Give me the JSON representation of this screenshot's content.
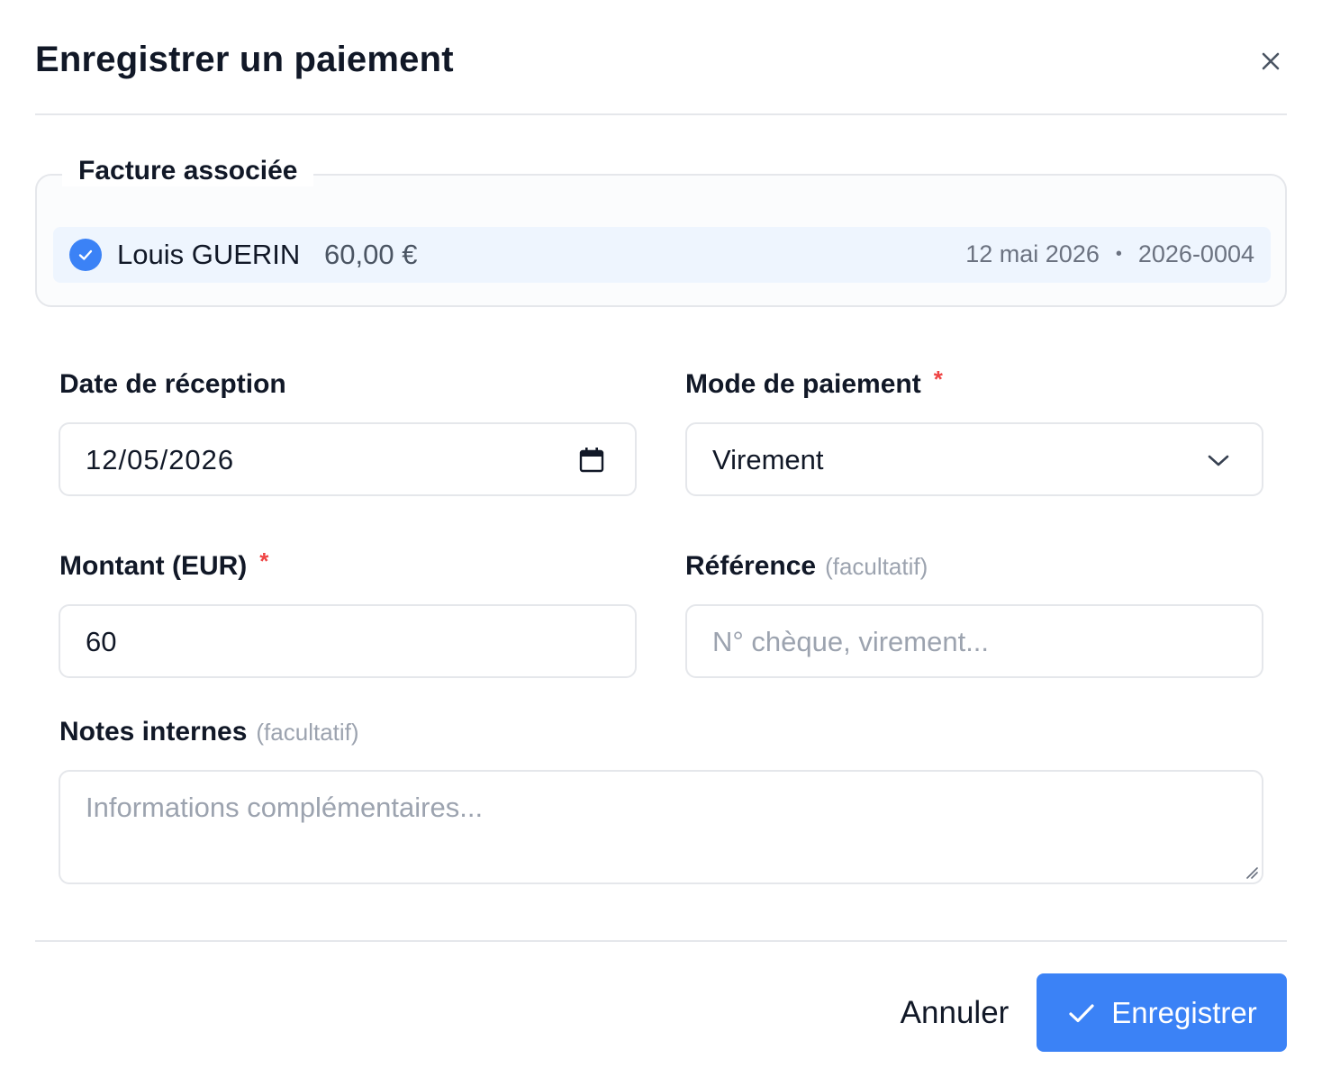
{
  "dialog": {
    "title": "Enregistrer un paiement"
  },
  "invoice": {
    "legend": "Facture associée",
    "client": "Louis GUERIN",
    "amount": "60,00 €",
    "date": "12 mai 2026",
    "separator": "•",
    "number": "2026-0004"
  },
  "form": {
    "date": {
      "label": "Date de réception",
      "value": "12/05/2026"
    },
    "method": {
      "label": "Mode de paiement",
      "required": "*",
      "value": "Virement"
    },
    "amount": {
      "label": "Montant (EUR)",
      "required": "*",
      "value": "60"
    },
    "reference": {
      "label": "Référence",
      "optional": "(facultatif)",
      "placeholder": "N° chèque, virement..."
    },
    "notes": {
      "label": "Notes internes",
      "optional": "(facultatif)",
      "placeholder": "Informations complémentaires..."
    }
  },
  "actions": {
    "cancel_label": "Annuler",
    "save_label": "Enregistrer"
  },
  "icons": {
    "close": "close-icon",
    "selected": "check-circle-icon",
    "calendar": "calendar-icon",
    "dropdown": "chevron-down-icon",
    "save": "check-icon",
    "resize": "resize-handle-icon"
  },
  "colors": {
    "primary": "#3b82f6",
    "required": "#ef4444",
    "selected_row": "#eef5fe"
  }
}
